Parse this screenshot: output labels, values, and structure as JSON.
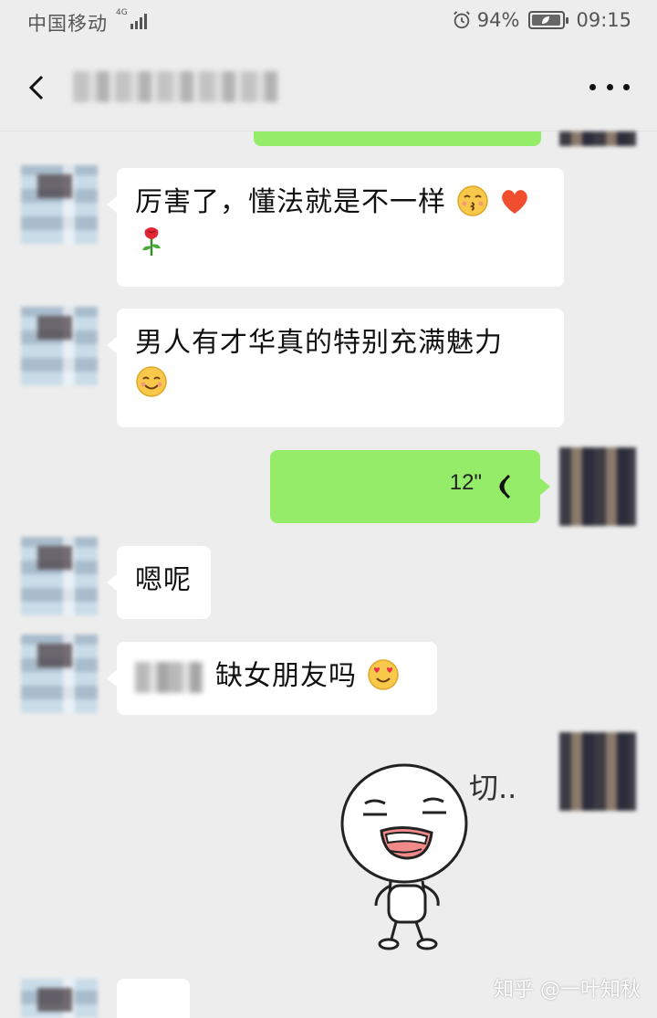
{
  "status_bar": {
    "carrier": "中国移动",
    "network": "4G",
    "battery": "94%",
    "battery_level": 0.94,
    "time": "09:15",
    "icons": [
      "signal-icon",
      "alarm-icon",
      "battery-icon"
    ]
  },
  "nav": {
    "back_icon": "chevron-left-icon",
    "more_icon": "more-dots-icon"
  },
  "messages": [
    {
      "side": "left",
      "type": "text",
      "text": "厉害了，懂法就是不一样",
      "emojis": [
        "kissing-face-emoji",
        "heart-emoji",
        "rose-emoji"
      ]
    },
    {
      "side": "left",
      "type": "text",
      "text": "男人有才华真的特别充满魅力",
      "emojis": [
        "smiling-face-emoji"
      ]
    },
    {
      "side": "right",
      "type": "voice",
      "duration": "12\""
    },
    {
      "side": "left",
      "type": "text",
      "text": "嗯呢"
    },
    {
      "side": "left",
      "type": "text",
      "text": "缺女朋友吗",
      "emojis": [
        "heart-eyes-emoji"
      ]
    },
    {
      "side": "right",
      "type": "sticker",
      "caption": "切.."
    }
  ],
  "watermark": "知乎 @一叶知秋",
  "colors": {
    "background": "#ededed",
    "self_bubble": "#95ec69",
    "other_bubble": "#ffffff"
  }
}
